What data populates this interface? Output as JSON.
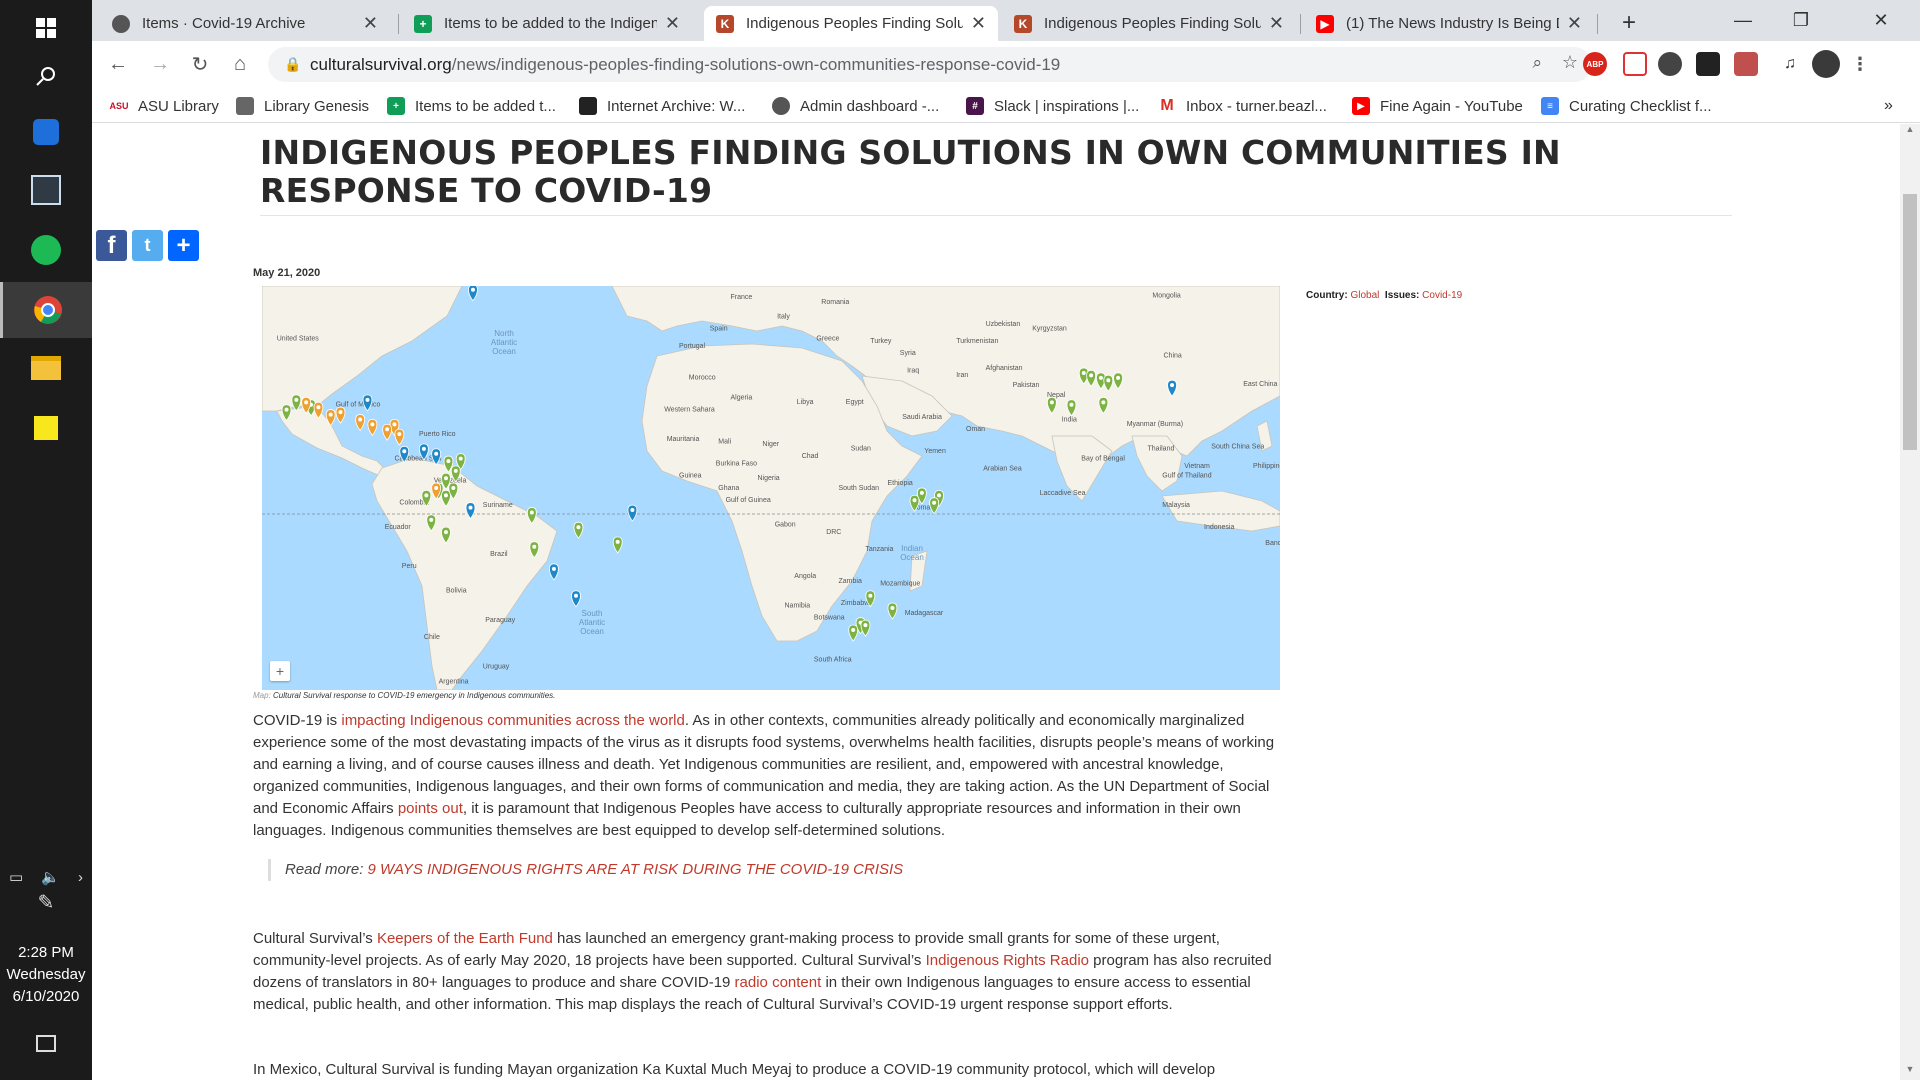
{
  "browser": {
    "tabs": [
      {
        "title": "Items · Covid-19 Archive",
        "active": false
      },
      {
        "title": "Items to be added to the Indigen",
        "active": false
      },
      {
        "title": "Indigenous Peoples Finding Solu",
        "active": true
      },
      {
        "title": "Indigenous Peoples Finding Solu",
        "active": false
      },
      {
        "title": "(1) The News Industry Is Being D",
        "active": false
      }
    ],
    "url_domain": "culturalsurvival.org",
    "url_path": "/news/indigenous-peoples-finding-solutions-own-communities-response-covid-19",
    "bookmarks": [
      "ASU Library",
      "Library Genesis",
      "Items to be added t...",
      "Internet Archive: W...",
      "Admin dashboard -...",
      "Slack | inspirations |...",
      "Inbox - turner.beazl...",
      "Fine Again - YouTube",
      "Curating Checklist f..."
    ],
    "extension_abp": "ABP"
  },
  "taskbar": {
    "time": "2:28 PM",
    "day": "Wednesday",
    "date": "6/10/2020"
  },
  "article": {
    "title": "INDIGENOUS PEOPLES FINDING SOLUTIONS IN OWN COMMUNITIES IN RESPONSE TO COVID-19",
    "date": "May 21, 2020",
    "country_label": "Country:",
    "country_value": "Global",
    "issues_label": "Issues:",
    "issues_value": "Covid-19",
    "map_caption_prefix": "Map:",
    "map_caption": "Cultural Survival response to COVID-19 emergency in Indigenous communities.",
    "map_zoom_label": "+",
    "p1_a": "COVID-19 is ",
    "p1_link1": "impacting Indigenous communities across the world",
    "p1_b": ". As in other contexts, communities already politically and economically marginalized experience some of the most devastating impacts of the virus as it disrupts food systems, overwhelms health facilities, disrupts people’s means of working and earning a living, and of course causes illness and death. Yet Indigenous communities are resilient, and, empowered with ancestral knowledge, organized communities, Indigenous languages, and their own forms of communication and media, they are taking action. As the UN Department of Social and Economic Affairs ",
    "p1_link2": "points out",
    "p1_c": ", it is paramount that Indigenous Peoples have access to culturally appropriate resources and information in their own languages. Indigenous communities themselves are best equipped to develop self-determined solutions.",
    "readmore_label": "Read more: ",
    "readmore_link": "9 WAYS INDIGENOUS RIGHTS ARE AT RISK DURING THE COVID-19 CRISIS",
    "p2_a": "Cultural Survival’s ",
    "p2_link1": "Keepers of the Earth Fund",
    "p2_b": " has launched an emergency grant-making process to provide small grants for some of these urgent, community-level projects. As of early May 2020, 18 projects have been supported. Cultural Survival’s ",
    "p2_link2": "Indigenous Rights Radio",
    "p2_c": " program has also recruited dozens of translators in 80+ languages to produce and share COVID-19 ",
    "p2_link3": "radio content",
    "p2_d": " in their own Indigenous languages to ensure access to essential medical, public health, and other information. This map displays the reach of Cultural Survival’s COVID-19 urgent response support efforts.",
    "p3": "In Mexico, Cultural Survival is funding Mayan organization Ka Kuxtal Much Meyaj to produce a COVID-19 community protocol, which will develop"
  },
  "map": {
    "ocean_labels": [
      "North Atlantic Ocean",
      "South Atlantic Ocean",
      "Indian Ocean"
    ],
    "country_labels": [
      "United States",
      "France",
      "Romania",
      "Italy",
      "Spain",
      "Greece",
      "Turkey",
      "Turkmenistan",
      "Uzbekistan",
      "Kyrgyzstan",
      "Mongolia",
      "Portugal",
      "Syria",
      "Iraq",
      "Afghanistan",
      "China",
      "Morocco",
      "Algeria",
      "Libya",
      "Egypt",
      "Iran",
      "Saudi Arabia",
      "Pakistan",
      "Nepal",
      "India",
      "Western Sahara",
      "Mauritania",
      "Mali",
      "Niger",
      "Chad",
      "Sudan",
      "Yemen",
      "Oman",
      "Myanmar (Burma)",
      "Thailand",
      "Vietnam",
      "Philippines",
      "Burkina Faso",
      "Nigeria",
      "Ethiopia",
      "South Sudan",
      "Somalia",
      "Malaysia",
      "Indonesia",
      "Guinea",
      "Ghana",
      "Gabon",
      "DRC",
      "Tanzania",
      "Angola",
      "Zambia",
      "Mozambique",
      "Namibia",
      "Zimbabwe",
      "Botswana",
      "Madagascar",
      "South Africa",
      "Gulf of Mexico",
      "Puerto Rico",
      "Venezuela",
      "Suriname",
      "Colombia",
      "Ecuador",
      "Peru",
      "Brazil",
      "Bolivia",
      "Paraguay",
      "Chile",
      "Uruguay",
      "Argentina",
      "Caribbean Sea",
      "Arabian Sea",
      "Bay of Bengal",
      "South China Sea",
      "Laccadive Sea",
      "Gulf of Guinea",
      "Gulf of Thailand",
      "Banda Sea",
      "East China Sea"
    ],
    "colors": {
      "water": "#aadaff",
      "land": "#f5f2e9",
      "green_marker": "#7cb342",
      "orange_marker": "#f0a030",
      "blue_marker": "#1e88c8"
    }
  }
}
